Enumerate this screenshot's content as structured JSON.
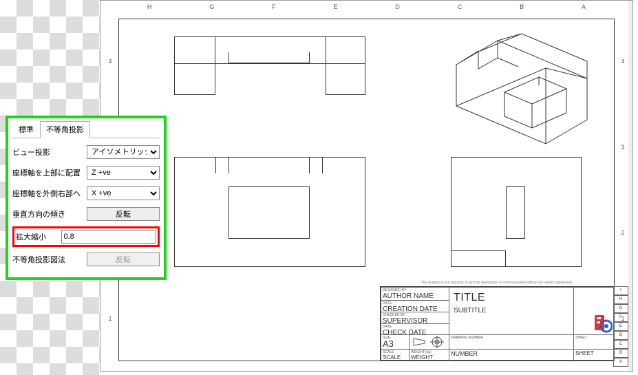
{
  "sheet": {
    "top_letters": [
      "A",
      "B",
      "C",
      "D",
      "E",
      "F",
      "G",
      "H"
    ],
    "side_numbers": [
      "1",
      "2",
      "3",
      "4"
    ]
  },
  "titleblock": {
    "designed_by_lbl": "DESIGNED BY:",
    "author": "AUTHOR NAME",
    "date_lbl": "DATE:",
    "creation_date": "CREATION DATE",
    "checked_by_lbl": "CHECKED BY:",
    "supervisor": "SUPERVISOR NAME",
    "date2_lbl": "DATE:",
    "check_date": "CHECK DATE",
    "size_lbl": "SIZE",
    "size": "A3",
    "title": "TITLE",
    "subtitle": "SUBTITLE",
    "scale_lbl": "SCALE",
    "scale": "SCALE",
    "weight_lbl": "WEIGHT (kg)",
    "weight": "WEIGHT",
    "drawing_no_lbl": "DRAWING NUMBER",
    "number": "NUMBER",
    "sheet_lbl": "SHEET",
    "sheet": "SHEET",
    "footer": "This drawing is our property; it can't be reproduced or communicated without our written agreement.",
    "right_letters": [
      "I",
      "H",
      "G",
      "F",
      "E",
      "D",
      "C",
      "B",
      "A"
    ]
  },
  "panel": {
    "tabs": {
      "standard": "標準",
      "axo": "不等角投影"
    },
    "view_projection": {
      "label": "ビュー投影",
      "options": [
        "アイソメトリック"
      ],
      "value": "アイソメトリック"
    },
    "axis_top": {
      "label": "座標軸を上部に配置",
      "options": [
        "Z +ve"
      ],
      "value": "Z +ve"
    },
    "axis_right": {
      "label": "座標軸を外側右部へ",
      "options": [
        "X +ve"
      ],
      "value": "X +ve"
    },
    "vertical_tilt": {
      "label": "垂直方向の傾き",
      "button": "反転"
    },
    "scale": {
      "label": "拡大縮小",
      "value": "0.8"
    },
    "axo_method": {
      "label": "不等角投影図法",
      "button": "反転"
    }
  }
}
